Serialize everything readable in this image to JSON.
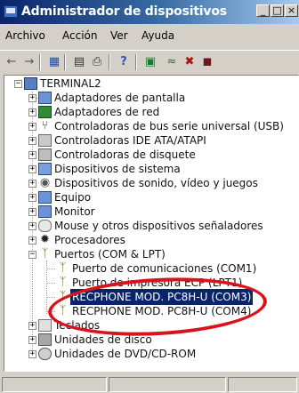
{
  "window": {
    "title": "Administrador de dispositivos",
    "controls": [
      "_",
      "□",
      "×"
    ]
  },
  "menu": [
    "Archivo",
    "Acción",
    "Ver",
    "Ayuda"
  ],
  "toolbar": {
    "buttons": [
      "back-arrow-icon",
      "forward-arrow-icon",
      "view-icon",
      "properties-icon",
      "print-icon",
      "help-icon",
      "scan-icon",
      "update-driver-icon",
      "uninstall-icon",
      "disable-icon"
    ]
  },
  "tree": {
    "root": "TERMINAL2",
    "categories": [
      {
        "label": "Adaptadores de pantalla",
        "icon": "display-adapter-icon"
      },
      {
        "label": "Adaptadores de red",
        "icon": "network-adapter-icon"
      },
      {
        "label": "Controladoras de bus serie universal (USB)",
        "icon": "usb-icon"
      },
      {
        "label": "Controladoras IDE ATA/ATAPI",
        "icon": "ide-controller-icon"
      },
      {
        "label": "Controladoras de disquete",
        "icon": "floppy-controller-icon"
      },
      {
        "label": "Dispositivos de sistema",
        "icon": "system-device-icon"
      },
      {
        "label": "Dispositivos de sonido, vídeo y juegos",
        "icon": "sound-icon"
      },
      {
        "label": "Equipo",
        "icon": "computer-icon"
      },
      {
        "label": "Monitor",
        "icon": "monitor-icon"
      },
      {
        "label": "Mouse y otros dispositivos señaladores",
        "icon": "mouse-icon"
      },
      {
        "label": "Procesadores",
        "icon": "processor-icon"
      }
    ],
    "ports": {
      "label": "Puertos (COM & LPT)",
      "children": [
        "Puerto de comunicaciones (COM1)",
        "Puerto de impresora ECP (LPT1)",
        "RECPHONE MOD. PC8H-U (COM3)",
        "RECPHONE MOD. PC8H-U (COM4)"
      ]
    },
    "after": [
      {
        "label": "Teclados",
        "icon": "keyboard-icon"
      },
      {
        "label": "Unidades de disco",
        "icon": "disk-drive-icon"
      },
      {
        "label": "Unidades de DVD/CD-ROM",
        "icon": "dvd-drive-icon"
      }
    ]
  },
  "colors": {
    "title_bar": "#0a246a",
    "selection": "#0a246a",
    "highlight_circle": "#d9121b"
  }
}
